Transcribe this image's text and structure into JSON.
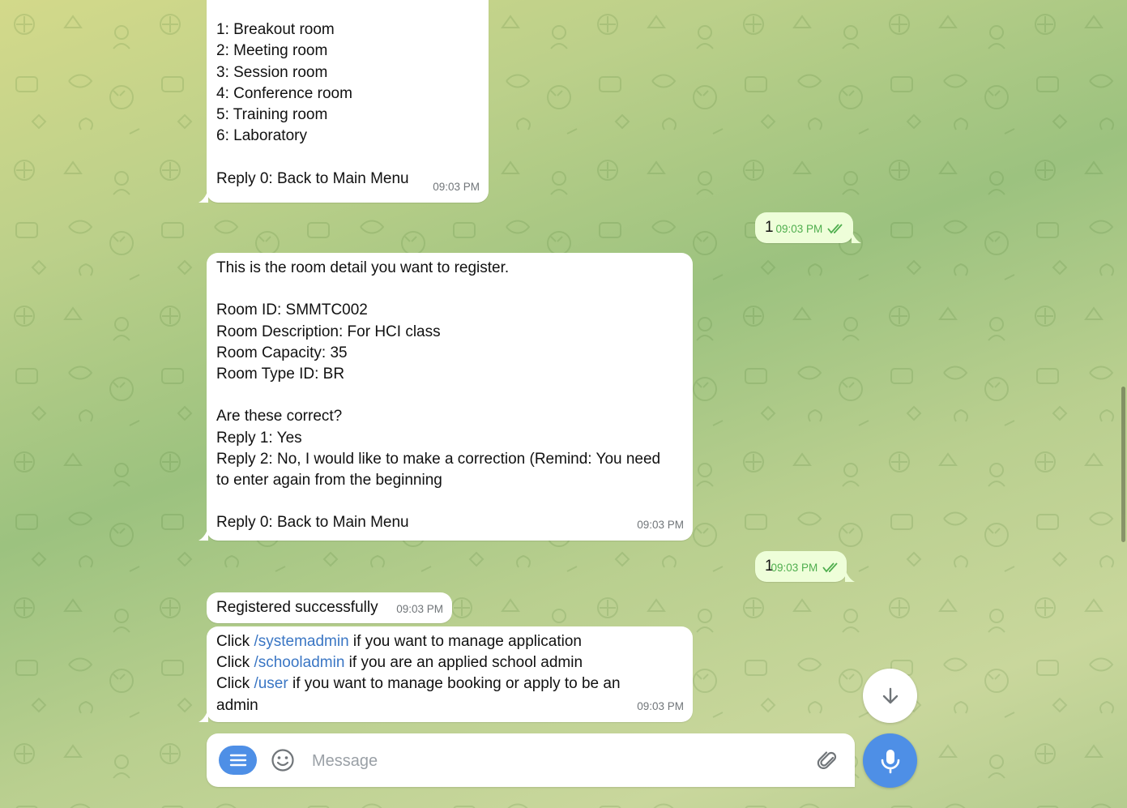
{
  "colors": {
    "accent": "#4e8fe6",
    "incoming_bubble": "#ffffff",
    "outgoing_bubble": "#eefed9",
    "outgoing_time": "#4fae4e",
    "command_link": "#3a76c4"
  },
  "messages": {
    "room_type_menu": {
      "lines": [
        "",
        "1: Breakout room",
        "2: Meeting room",
        "3: Session room",
        "4: Conference room",
        "5: Training room",
        "6: Laboratory",
        "",
        "Reply 0: Back to Main Menu"
      ],
      "time": "09:03 PM"
    },
    "reply_1a": {
      "text": "1",
      "time": "09:03 PM"
    },
    "room_detail": {
      "lines": [
        "This is the room detail you want to register.",
        "",
        "Room ID: SMMTC002",
        "Room Description: For HCI class",
        "Room Capacity: 35",
        "Room Type ID: BR",
        "",
        "Are these correct?",
        "Reply 1: Yes",
        "Reply 2: No, I would like to make a correction (Remind: You need",
        "to enter again from the beginning",
        "",
        "Reply 0: Back to Main Menu"
      ],
      "time": "09:03 PM"
    },
    "reply_1b": {
      "text": "1",
      "time": "09:03 PM"
    },
    "registered": {
      "text": "Registered successfully",
      "time": "09:03 PM"
    },
    "commands": {
      "line1": {
        "pre": "Click ",
        "cmd": "/systemadmin",
        "post": " if you want to manage application"
      },
      "line2": {
        "pre": "Click ",
        "cmd": "/schooladmin",
        "post": " if you are an applied school admin"
      },
      "line3": {
        "pre": "Click ",
        "cmd": "/user",
        "post": " if you want to manage booking or apply to be an"
      },
      "line4": "admin",
      "time": "09:03 PM"
    }
  },
  "composer": {
    "placeholder": "Message",
    "icons": {
      "menu": "menu-icon",
      "emoji": "smiley-icon",
      "attach": "paperclip-icon",
      "send": "microphone-icon",
      "scroll": "arrow-down-icon"
    }
  }
}
